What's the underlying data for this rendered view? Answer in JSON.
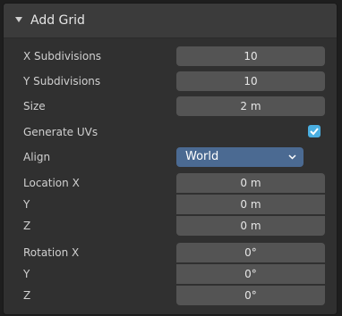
{
  "panel": {
    "title": "Add Grid",
    "collapse_icon": "triangle-down-icon"
  },
  "fields": {
    "x_subdivisions": {
      "label": "X Subdivisions",
      "value": "10"
    },
    "y_subdivisions": {
      "label": "Y Subdivisions",
      "value": "10"
    },
    "size": {
      "label": "Size",
      "value": "2 m"
    },
    "generate_uvs": {
      "label": "Generate UVs",
      "checked": true
    },
    "align": {
      "label": "Align",
      "value": "World"
    },
    "location": {
      "x": {
        "label": "Location X",
        "value": "0 m"
      },
      "y": {
        "label": "Y",
        "value": "0 m"
      },
      "z": {
        "label": "Z",
        "value": "0 m"
      }
    },
    "rotation": {
      "x": {
        "label": "Rotation X",
        "value": "0°"
      },
      "y": {
        "label": "Y",
        "value": "0°"
      },
      "z": {
        "label": "Z",
        "value": "0°"
      }
    }
  },
  "colors": {
    "panel_bg": "#303030",
    "field_bg": "#545454",
    "accent_dropdown": "#4b6a92",
    "checkbox": "#4aaee0"
  }
}
